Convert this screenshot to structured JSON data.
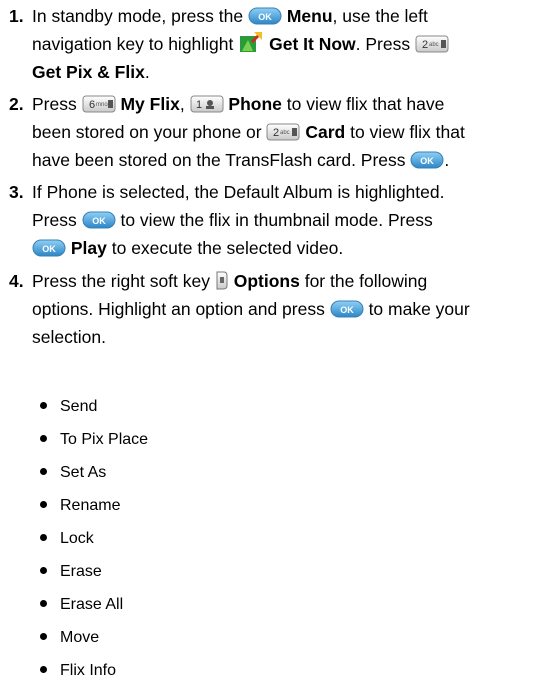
{
  "steps": [
    {
      "number": "1.",
      "s1a": "In standby mode, press the ",
      "s1b": "Menu",
      "s1c": ", use the left",
      "s1d": "navigation key to highlight ",
      "s1e": "Get It Now",
      "s1f": ". Press ",
      "s1g": "Get Pix & Flix",
      "s1h": "."
    },
    {
      "number": "2.",
      "s2a": "Press ",
      "s2b": "My Flix",
      "s2c": ", ",
      "s2d": "Phone",
      "s2e": " to view flix that have",
      "s2f": "been stored on your phone or ",
      "s2g": "Card",
      "s2h": " to view flix that",
      "s2i": "have been stored on the TransFlash card. Press ",
      "s2j": "."
    },
    {
      "number": "3.",
      "s3a": "If Phone is selected, the Default Album is highlighted.",
      "s3b": "Press ",
      "s3c": " to view the flix in thumbnail mode. Press",
      "s3d": "Play",
      "s3e": " to execute the selected video."
    },
    {
      "number": "4.",
      "s4a": "Press the right soft key ",
      "s4b": "Options",
      "s4c": " for the following",
      "s4d": "options. Highlight an option and press ",
      "s4e": " to make your",
      "s4f": "selection."
    }
  ],
  "options": [
    "Send",
    "To Pix Place",
    "Set As",
    "Rename",
    "Lock",
    "Erase",
    "Erase All",
    "Move",
    "Flix Info"
  ],
  "keys": {
    "ok": "OK",
    "two": "2",
    "two_sub": "abc",
    "six": "6",
    "six_sub": "mno",
    "one": "1"
  },
  "icon_names": [
    "ok-key-icon",
    "get-it-now-icon",
    "key-2-abc-icon",
    "key-6-mno-icon",
    "key-1-icon",
    "right-soft-key-icon"
  ],
  "colors": {
    "ok_key": "#3f9fd8",
    "get_it_now_green": "#2a9a3a",
    "get_it_now_red": "#d8261c"
  }
}
